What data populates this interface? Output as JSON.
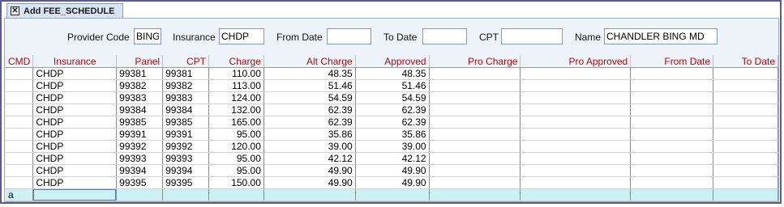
{
  "window": {
    "tab_title": "Add FEE_SCHEDULE",
    "close_glyph": "✕"
  },
  "filters": {
    "provider_code_label": "Provider Code",
    "provider_code_value": "BING",
    "insurance_label": "Insurance",
    "insurance_value": "CHDP",
    "from_date_label": "From Date",
    "from_date_value": "",
    "to_date_label": "To Date",
    "to_date_value": "",
    "cpt_label": "CPT",
    "cpt_value": "",
    "name_label": "Name",
    "name_value": "CHANDLER BING MD"
  },
  "grid": {
    "columns": [
      "CMD",
      "Insurance",
      "Panel",
      "CPT",
      "Charge",
      "Alt Charge",
      "Approved",
      "Pro Charge",
      "Pro Approved",
      "From Date",
      "To Date"
    ],
    "rows": [
      {
        "cmd": "",
        "insurance": "CHDP",
        "panel": "99381",
        "cpt": "99381",
        "charge": "110.00",
        "alt_charge": "48.35",
        "approved": "48.35",
        "pro_charge": "",
        "pro_approved": "",
        "from_date": "",
        "to_date": ""
      },
      {
        "cmd": "",
        "insurance": "CHDP",
        "panel": "99382",
        "cpt": "99382",
        "charge": "113.00",
        "alt_charge": "51.46",
        "approved": "51.46",
        "pro_charge": "",
        "pro_approved": "",
        "from_date": "",
        "to_date": ""
      },
      {
        "cmd": "",
        "insurance": "CHDP",
        "panel": "99383",
        "cpt": "99383",
        "charge": "124.00",
        "alt_charge": "54.59",
        "approved": "54.59",
        "pro_charge": "",
        "pro_approved": "",
        "from_date": "",
        "to_date": ""
      },
      {
        "cmd": "",
        "insurance": "CHDP",
        "panel": "99384",
        "cpt": "99384",
        "charge": "132.00",
        "alt_charge": "62.39",
        "approved": "62.39",
        "pro_charge": "",
        "pro_approved": "",
        "from_date": "",
        "to_date": ""
      },
      {
        "cmd": "",
        "insurance": "CHDP",
        "panel": "99385",
        "cpt": "99385",
        "charge": "165.00",
        "alt_charge": "62.39",
        "approved": "62.39",
        "pro_charge": "",
        "pro_approved": "",
        "from_date": "",
        "to_date": ""
      },
      {
        "cmd": "",
        "insurance": "CHDP",
        "panel": "99391",
        "cpt": "99391",
        "charge": "95.00",
        "alt_charge": "35.86",
        "approved": "35.86",
        "pro_charge": "",
        "pro_approved": "",
        "from_date": "",
        "to_date": ""
      },
      {
        "cmd": "",
        "insurance": "CHDP",
        "panel": "99392",
        "cpt": "99392",
        "charge": "120.00",
        "alt_charge": "39.00",
        "approved": "39.00",
        "pro_charge": "",
        "pro_approved": "",
        "from_date": "",
        "to_date": ""
      },
      {
        "cmd": "",
        "insurance": "CHDP",
        "panel": "99393",
        "cpt": "99393",
        "charge": "95.00",
        "alt_charge": "42.12",
        "approved": "42.12",
        "pro_charge": "",
        "pro_approved": "",
        "from_date": "",
        "to_date": ""
      },
      {
        "cmd": "",
        "insurance": "CHDP",
        "panel": "99394",
        "cpt": "99394",
        "charge": "95.00",
        "alt_charge": "49.90",
        "approved": "49.90",
        "pro_charge": "",
        "pro_approved": "",
        "from_date": "",
        "to_date": ""
      },
      {
        "cmd": "",
        "insurance": "CHDP",
        "panel": "99395",
        "cpt": "99395",
        "charge": "150.00",
        "alt_charge": "49.90",
        "approved": "49.90",
        "pro_charge": "",
        "pro_approved": "",
        "from_date": "",
        "to_date": ""
      }
    ],
    "new_row": {
      "cmd": "a"
    }
  },
  "colors": {
    "header_text": "#a01010",
    "new_row_bg": "#ccf0f4",
    "panel_bg": "#eef3fa"
  }
}
